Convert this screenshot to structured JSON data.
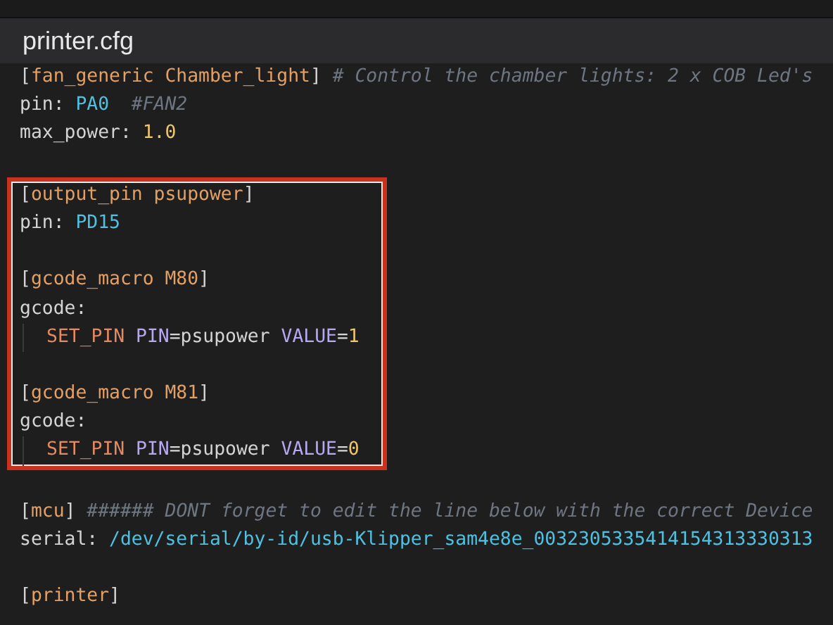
{
  "window": {
    "title": "printer.cfg"
  },
  "blocks": [
    {
      "highlighted": false,
      "lines": [
        {
          "kind": "code",
          "tokens": [
            {
              "kind": "punct",
              "text": "["
            },
            {
              "kind": "section",
              "text": "fan_generic Chamber_light"
            },
            {
              "kind": "punct",
              "text": "] "
            },
            {
              "kind": "comment",
              "text": "# Control the chamber lights: 2 x COB Led's"
            }
          ]
        },
        {
          "kind": "code",
          "tokens": [
            {
              "kind": "key",
              "text": "pin: "
            },
            {
              "kind": "value",
              "text": "PA0"
            },
            {
              "kind": "comment",
              "text": "  #FAN2"
            }
          ]
        },
        {
          "kind": "code",
          "tokens": [
            {
              "kind": "key",
              "text": "max_power: "
            },
            {
              "kind": "number",
              "text": "1.0"
            }
          ]
        },
        {
          "kind": "blank"
        }
      ]
    },
    {
      "highlighted": true,
      "lines": [
        {
          "kind": "code",
          "tokens": [
            {
              "kind": "punct",
              "text": "["
            },
            {
              "kind": "section",
              "text": "output_pin psupower"
            },
            {
              "kind": "punct",
              "text": "]"
            }
          ]
        },
        {
          "kind": "code",
          "tokens": [
            {
              "kind": "key",
              "text": "pin: "
            },
            {
              "kind": "value",
              "text": "PD15"
            }
          ]
        },
        {
          "kind": "blank"
        },
        {
          "kind": "code",
          "tokens": [
            {
              "kind": "punct",
              "text": "["
            },
            {
              "kind": "section",
              "text": "gcode_macro M80"
            },
            {
              "kind": "punct",
              "text": "]"
            }
          ]
        },
        {
          "kind": "code",
          "tokens": [
            {
              "kind": "key",
              "text": "gcode:"
            }
          ]
        },
        {
          "kind": "indented",
          "tokens": [
            {
              "kind": "keyword",
              "text": "SET_PIN "
            },
            {
              "kind": "param",
              "text": "PIN"
            },
            {
              "kind": "key",
              "text": "=psupower "
            },
            {
              "kind": "param",
              "text": "VALUE"
            },
            {
              "kind": "key",
              "text": "="
            },
            {
              "kind": "number",
              "text": "1"
            }
          ]
        },
        {
          "kind": "blank"
        },
        {
          "kind": "code",
          "tokens": [
            {
              "kind": "punct",
              "text": "["
            },
            {
              "kind": "section",
              "text": "gcode_macro M81"
            },
            {
              "kind": "punct",
              "text": "]"
            }
          ]
        },
        {
          "kind": "code",
          "tokens": [
            {
              "kind": "key",
              "text": "gcode:"
            }
          ]
        },
        {
          "kind": "indented",
          "tokens": [
            {
              "kind": "keyword",
              "text": "SET_PIN "
            },
            {
              "kind": "param",
              "text": "PIN"
            },
            {
              "kind": "key",
              "text": "=psupower "
            },
            {
              "kind": "param",
              "text": "VALUE"
            },
            {
              "kind": "key",
              "text": "="
            },
            {
              "kind": "number",
              "text": "0"
            }
          ]
        }
      ]
    },
    {
      "highlighted": false,
      "lines": [
        {
          "kind": "blank"
        },
        {
          "kind": "code",
          "tokens": [
            {
              "kind": "punct",
              "text": "["
            },
            {
              "kind": "section",
              "text": "mcu"
            },
            {
              "kind": "punct",
              "text": "] "
            },
            {
              "kind": "comment",
              "text": "###### DONT forget to edit the line below with the correct Device"
            }
          ]
        },
        {
          "kind": "code",
          "tokens": [
            {
              "kind": "key",
              "text": "serial: "
            },
            {
              "kind": "value",
              "text": "/dev/serial/by-id/usb-Klipper_sam4e8e_0032305335414154313330313"
            }
          ]
        },
        {
          "kind": "blank"
        },
        {
          "kind": "code",
          "tokens": [
            {
              "kind": "punct",
              "text": "["
            },
            {
              "kind": "section",
              "text": "printer"
            },
            {
              "kind": "punct",
              "text": "]"
            }
          ]
        }
      ]
    }
  ]
}
